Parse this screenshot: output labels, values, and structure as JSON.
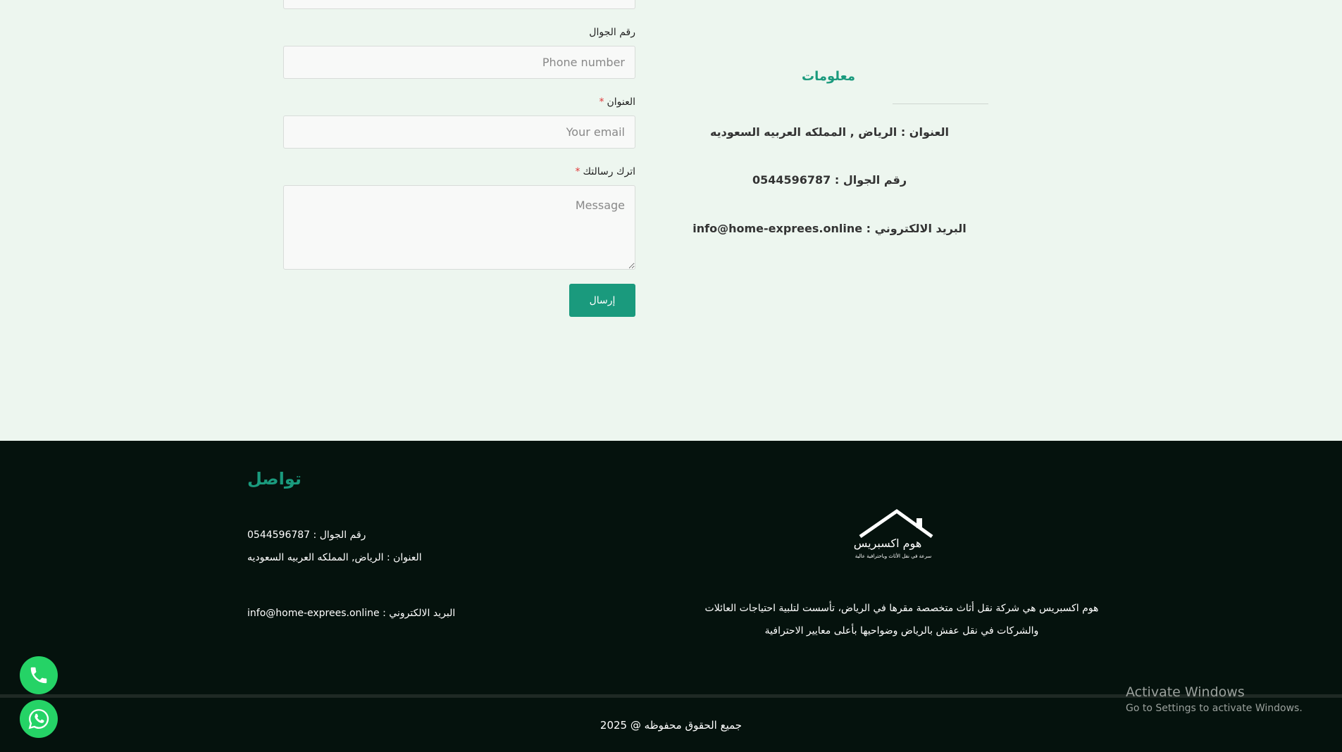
{
  "form": {
    "phone_label": "رقم الجوال",
    "phone_placeholder": "Phone number",
    "address_label": "العنوان",
    "address_placeholder": "Your email",
    "message_label": "اترك رسالتك",
    "message_placeholder": "Message",
    "required_mark": "*",
    "submit_label": "إرسال"
  },
  "info": {
    "title": "معلومات",
    "address": "العنوان : الرياض , المملكه العربيه السعوديه",
    "phone": "رقم الجوال : 0544596787",
    "email": "البريد الالكتروني : info@home-exprees.online"
  },
  "footer": {
    "contact_title": "تواصل",
    "phone": "رقم الجوال : 0544596787",
    "address": "العنوان : الرياض, المملكه العربيه السعوديه",
    "email": "البريد الالكتروني : info@home-exprees.online",
    "logo_name": "هوم اكسبريس",
    "logo_tagline": "سرعة في نقل الأثاث وباحترافية عالية",
    "desc_line1": "هوم اكسبريس هي شركة نقل أثاث متخصصة مقرها في الرياض، تأسست لتلبية احتياجات العائلات",
    "desc_line2": "والشركات في نقل عفش بالرياض وضواحيها بأعلى معايير الاحترافية",
    "copyright": "جميع الحقوق محفوظه @ 2025"
  },
  "os_watermark": {
    "line1": "Activate Windows",
    "line2": "Go to Settings to activate Windows."
  },
  "floating": {
    "phone_icon": "phone-icon",
    "whatsapp_icon": "whatsapp-icon"
  },
  "colors": {
    "accent": "#1a9a7d",
    "footer_bg": "#05120d",
    "page_bg": "#edf6ef",
    "float_btn": "#25d366"
  }
}
